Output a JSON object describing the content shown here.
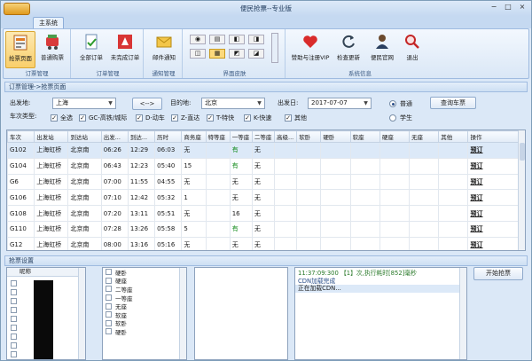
{
  "window": {
    "title": "便民抢票--专业版",
    "tab": "主系统",
    "controls": [
      "−",
      "□",
      "×"
    ]
  },
  "ribbon": {
    "groups": [
      {
        "label": "订票管理",
        "buttons": [
          {
            "label": "抢票页面",
            "icon": "ticket-icon",
            "selected": true
          },
          {
            "label": "普通购票",
            "icon": "cart-icon",
            "selected": false
          }
        ]
      },
      {
        "label": "订单管理",
        "buttons": [
          {
            "label": "全部订单",
            "icon": "orders-icon",
            "selected": false
          },
          {
            "label": "未完成订单",
            "icon": "pending-orders-icon",
            "selected": false
          }
        ]
      },
      {
        "label": "通知管理",
        "buttons": [
          {
            "label": "邮件通知",
            "icon": "mail-icon",
            "selected": false
          }
        ]
      },
      {
        "label": "界面皮肤",
        "buttons": []
      },
      {
        "label": "系统信息",
        "buttons": [
          {
            "label": "赞助与注册VIP",
            "icon": "heart-icon",
            "selected": false
          },
          {
            "label": "检查更新",
            "icon": "refresh-icon",
            "selected": false
          },
          {
            "label": "便民官网",
            "icon": "user-icon",
            "selected": false
          },
          {
            "label": "退出",
            "icon": "search-icon",
            "selected": false
          }
        ]
      }
    ],
    "skins": [
      "◉",
      "▤",
      "◧",
      "◨",
      "◫",
      "▦",
      "◩",
      "◪"
    ]
  },
  "booking": {
    "panel_title": "订票管理->抢票页面",
    "from_label": "出发地:",
    "from_value": "上海",
    "swap_label": "<-->",
    "to_label": "目的地:",
    "to_value": "北京",
    "date_label": "出发日:",
    "date_value": "2017-07-07",
    "radio_normal": "普通",
    "radio_student": "学生",
    "query_button": "查询车票",
    "type_label": "车次类型:",
    "types": [
      "全选",
      "GC-高铁/城际",
      "D-动车",
      "Z-直达",
      "T-特快",
      "K-快速",
      "其他"
    ]
  },
  "grid": {
    "columns": [
      "车次",
      "出发站",
      "到达站",
      "出发...",
      "到达...",
      "历时",
      "商务座",
      "特等座",
      "一等座",
      "二等座",
      "高级...",
      "软卧",
      "硬卧",
      "软座",
      "硬座",
      "无座",
      "其他",
      "操作"
    ],
    "rows": [
      [
        "G102",
        "上海虹桥",
        "北京南",
        "06:26",
        "12:29",
        "06:03",
        "无",
        "",
        "有",
        "无",
        "",
        "",
        "",
        "",
        "",
        "",
        "",
        "预订"
      ],
      [
        "G104",
        "上海虹桥",
        "北京南",
        "06:43",
        "12:23",
        "05:40",
        "15",
        "",
        "有",
        "无",
        "",
        "",
        "",
        "",
        "",
        "",
        "",
        "预订"
      ],
      [
        "G6",
        "上海虹桥",
        "北京南",
        "07:00",
        "11:55",
        "04:55",
        "无",
        "",
        "无",
        "无",
        "",
        "",
        "",
        "",
        "",
        "",
        "",
        "预订"
      ],
      [
        "G106",
        "上海虹桥",
        "北京南",
        "07:10",
        "12:42",
        "05:32",
        "1",
        "",
        "无",
        "无",
        "",
        "",
        "",
        "",
        "",
        "",
        "",
        "预订"
      ],
      [
        "G108",
        "上海虹桥",
        "北京南",
        "07:20",
        "13:11",
        "05:51",
        "无",
        "",
        "16",
        "无",
        "",
        "",
        "",
        "",
        "",
        "",
        "",
        "预订"
      ],
      [
        "G110",
        "上海虹桥",
        "北京南",
        "07:28",
        "13:26",
        "05:58",
        "5",
        "",
        "有",
        "无",
        "",
        "",
        "",
        "",
        "",
        "",
        "",
        "预订"
      ],
      [
        "G12",
        "上海虹桥",
        "北京南",
        "08:00",
        "13:16",
        "05:16",
        "无",
        "",
        "无",
        "无",
        "",
        "",
        "",
        "",
        "",
        "",
        "",
        "预订"
      ]
    ]
  },
  "settings": {
    "title": "抢票设置",
    "passenger_header": "昵称",
    "seat_types": [
      "硬卧",
      "硬座",
      "二等座",
      "一等座",
      "无座",
      "软座",
      "软卧",
      "硬卧"
    ],
    "log_lines": [
      "11:37:09:300 【1】次,执行耗时[852]毫秒",
      "CDN加载完成",
      "正在加载CDN..."
    ],
    "start_button": "开始抢票"
  }
}
